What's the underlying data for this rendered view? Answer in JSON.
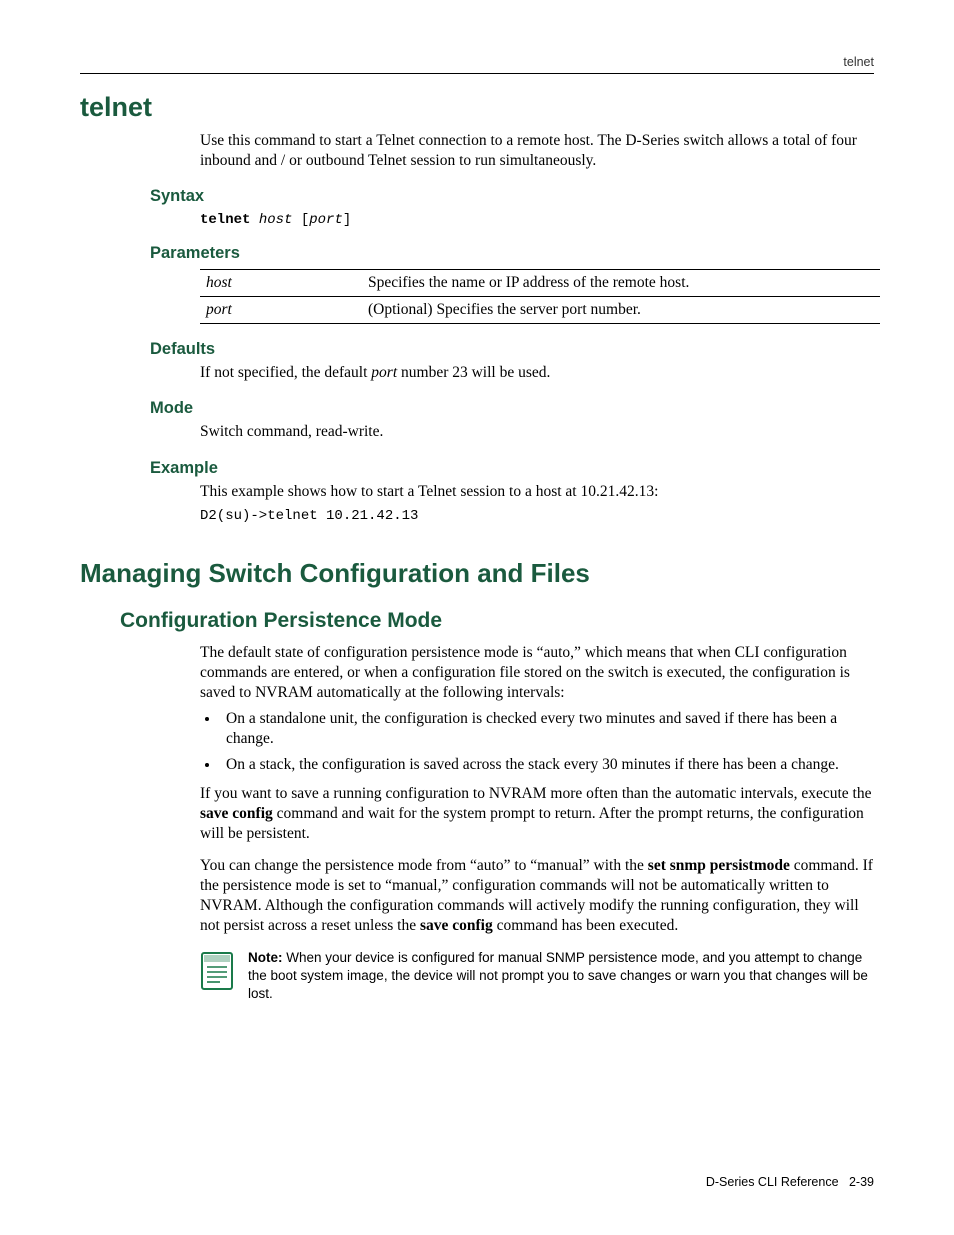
{
  "header": {
    "right": "telnet"
  },
  "title": "telnet",
  "intro": "Use this command to start a Telnet connection to a remote host. The D‑Series switch allows a total of four inbound and / or outbound Telnet session to run simultaneously.",
  "syntax": {
    "heading": "Syntax",
    "keyword": "telnet",
    "arg1": "host",
    "bracket_open": " [",
    "arg2": "port",
    "bracket_close": "]"
  },
  "parameters": {
    "heading": "Parameters",
    "rows": [
      {
        "name": "host",
        "desc": "Specifies the name or IP address of the remote host."
      },
      {
        "name": "port",
        "desc": "(Optional) Specifies the server port number."
      }
    ]
  },
  "defaults": {
    "heading": "Defaults",
    "text_a": "If not specified, the default ",
    "text_em": "port",
    "text_b": " number 23 will be used."
  },
  "mode": {
    "heading": "Mode",
    "text": "Switch command, read‑write."
  },
  "example": {
    "heading": "Example",
    "text": "This example shows how to start a Telnet session to a host at 10.21.42.13:",
    "code": "D2(su)->telnet 10.21.42.13"
  },
  "section2": {
    "heading": "Managing Switch Configuration and Files",
    "sub": "Configuration Persistence Mode",
    "p1": "The default state of configuration persistence mode is “auto,” which means that when CLI configuration commands are entered, or when a configuration file stored on the switch is executed, the configuration is saved to NVRAM automatically at the following intervals:",
    "bullets": [
      "On a standalone unit, the configuration is checked every two minutes and saved if there has been a change.",
      "On a stack, the configuration is saved across the stack every 30 minutes if there has been a change."
    ],
    "p2_a": "If you want to save a running configuration to NVRAM more often than the automatic intervals, execute the ",
    "p2_b1": "save config",
    "p2_c": " command and wait for the system prompt to return. After the prompt returns, the configuration will be persistent.",
    "p3_a": "You can change the persistence mode from “auto” to “manual” with the ",
    "p3_b1": "set snmp persistmode",
    "p3_b": " command. If the persistence mode is set to “manual,” configuration commands will not be automatically written to NVRAM. Although the configuration commands will actively modify the running configuration, they will not persist across a reset unless the ",
    "p3_b2": "save config",
    "p3_c": " command has been executed.",
    "note_lead": "Note:",
    "note": " When your device is configured for manual SNMP persistence mode, and you attempt to change the boot system image, the device will not prompt you to save changes or warn you that changes will be lost."
  },
  "footer": {
    "left": "D-Series CLI Reference",
    "right": "2-39"
  }
}
